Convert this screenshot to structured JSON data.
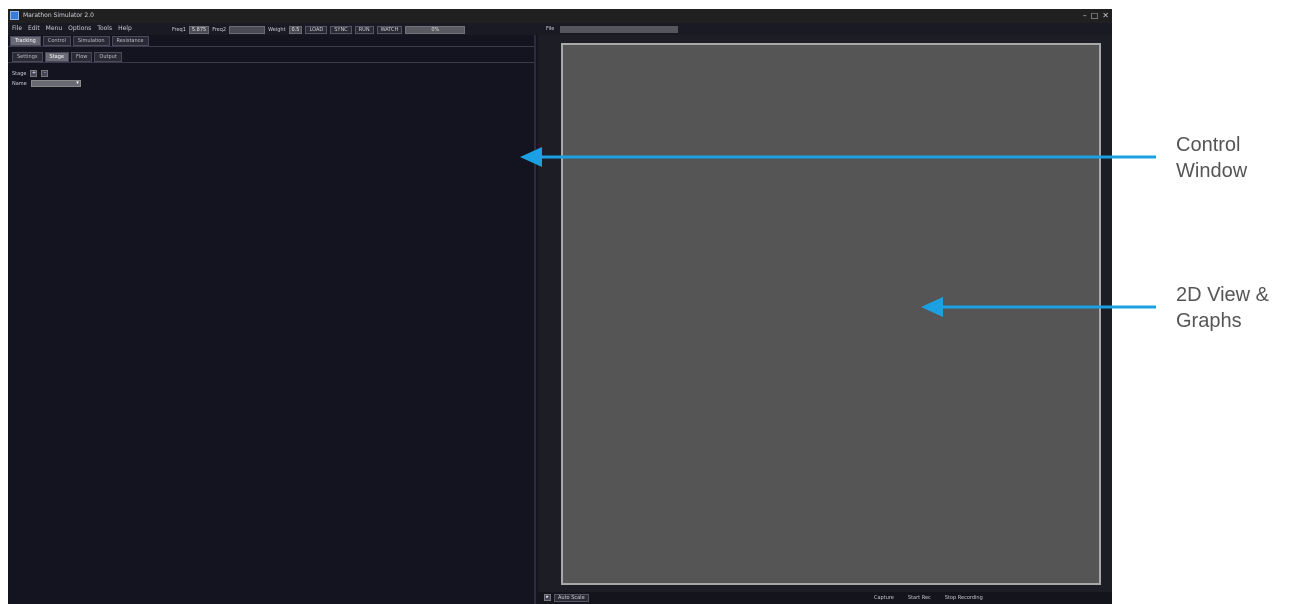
{
  "app": {
    "title": "Marathon Simulator 2.0",
    "window_controls": [
      "–",
      "□",
      "✕"
    ]
  },
  "menubar": {
    "items": [
      "File",
      "Edit",
      "Menu",
      "Options",
      "Tools",
      "Help"
    ],
    "freq1_label": "Freq1",
    "freq1_value": "5.875",
    "freq2_label": "Freq2",
    "freq2_value": "",
    "weight_label": "Weight",
    "weight_value": "0.5",
    "mode_buttons": [
      "LOAD",
      "SYNC",
      "RUN",
      "WATCH"
    ],
    "status_value": "0%",
    "file_label": "File"
  },
  "left_panel": {
    "main_tabs": [
      "Tracking",
      "Control",
      "Simulation",
      "Resistance"
    ],
    "main_tab_active": 0,
    "sub_tabs": [
      "Settings",
      "Stage",
      "Flow",
      "Output"
    ],
    "sub_tab_active": 1,
    "stage_label": "Stage",
    "stage_plus": "+",
    "stage_minus": "-",
    "name_label": "Name",
    "name_value": ""
  },
  "right_panel": {
    "bottom_left_button": "Auto Scale",
    "bottom_right_items": [
      "Capture",
      "Start Rec",
      "Stop Recording"
    ]
  },
  "annotations": {
    "control_window": [
      "Control",
      "Window"
    ],
    "view_graphs": [
      "2D View &",
      "Graphs"
    ],
    "arrow_color": "#1ba1e2"
  }
}
